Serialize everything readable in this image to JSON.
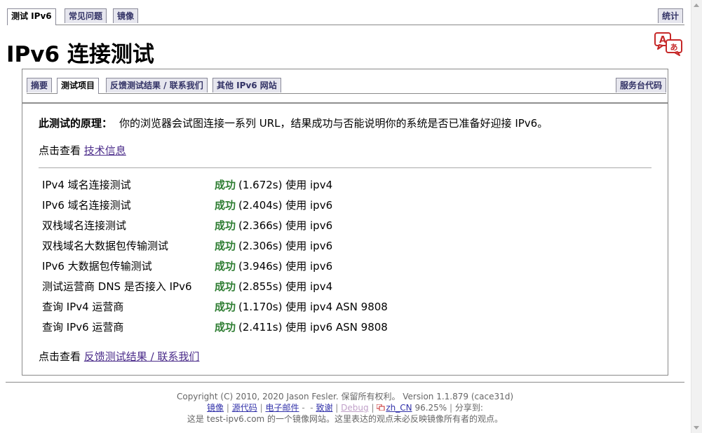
{
  "top_tabs": [
    {
      "label": "测试 IPv6",
      "active": true
    },
    {
      "label": "常见问题",
      "active": false
    },
    {
      "label": "镜像",
      "active": false
    }
  ],
  "stats_tab": "统计",
  "page_title": "IPv6 连接测试",
  "sub_tabs": [
    {
      "label": "摘要"
    },
    {
      "label": "测试项目",
      "active": true
    },
    {
      "label": "反馈测试结果 / 联系我们"
    },
    {
      "label": "其他 IPv6 网站"
    }
  ],
  "helpdesk_tab": "服务台代码",
  "principle": {
    "heading": "此测试的原理：",
    "text": "你的浏览器会试图连接一系列 URL，结果成功与否能说明你的系统是否已准备好迎接 IPv6。"
  },
  "tech_info": {
    "prefix": "点击查看",
    "link": "技术信息"
  },
  "results": [
    {
      "label": "IPv4 域名连接测试",
      "status": "成功",
      "detail": "(1.672s) 使用 ipv4"
    },
    {
      "label": "IPv6 域名连接测试",
      "status": "成功",
      "detail": "(2.404s) 使用 ipv6"
    },
    {
      "label": "双栈域名连接测试",
      "status": "成功",
      "detail": "(2.366s) 使用 ipv6"
    },
    {
      "label": "双栈域名大数据包传输测试",
      "status": "成功",
      "detail": "(2.306s) 使用 ipv6"
    },
    {
      "label": "IPv6 大数据包传输测试",
      "status": "成功",
      "detail": "(3.946s) 使用 ipv6"
    },
    {
      "label": "测试运营商 DNS 是否接入 IPv6",
      "status": "成功",
      "detail": "(2.855s) 使用 ipv4"
    },
    {
      "label": "查询 IPv4 运营商",
      "status": "成功",
      "detail": "(1.170s) 使用 ipv4 ASN 9808"
    },
    {
      "label": "查询 IPv6 运营商",
      "status": "成功",
      "detail": "(2.411s) 使用 ipv6 ASN 9808"
    }
  ],
  "feedback": {
    "prefix": "点击查看",
    "link": "反馈测试结果 / 联系我们"
  },
  "footer": {
    "copyright": "Copyright (C) 2010, 2020 Jason Fesler. 保留所有权利。 Version 1.1.879 (cace31d)",
    "links": {
      "mirror": "镜像",
      "source": "源代码",
      "email": "电子邮件",
      "thanks": "致谢",
      "debug": "Debug",
      "locale": "zh_CN",
      "locale_pct": "96.25%",
      "share": "分享到:"
    },
    "mirror_note": "这是 test-ipv6.com 的一个镜像网站。这里表达的观点未必反映镜像所有者的观点。"
  },
  "colors": {
    "success": "#2e7d32",
    "link": "#4b2c8a",
    "tab_bg": "#e6e6ee"
  }
}
